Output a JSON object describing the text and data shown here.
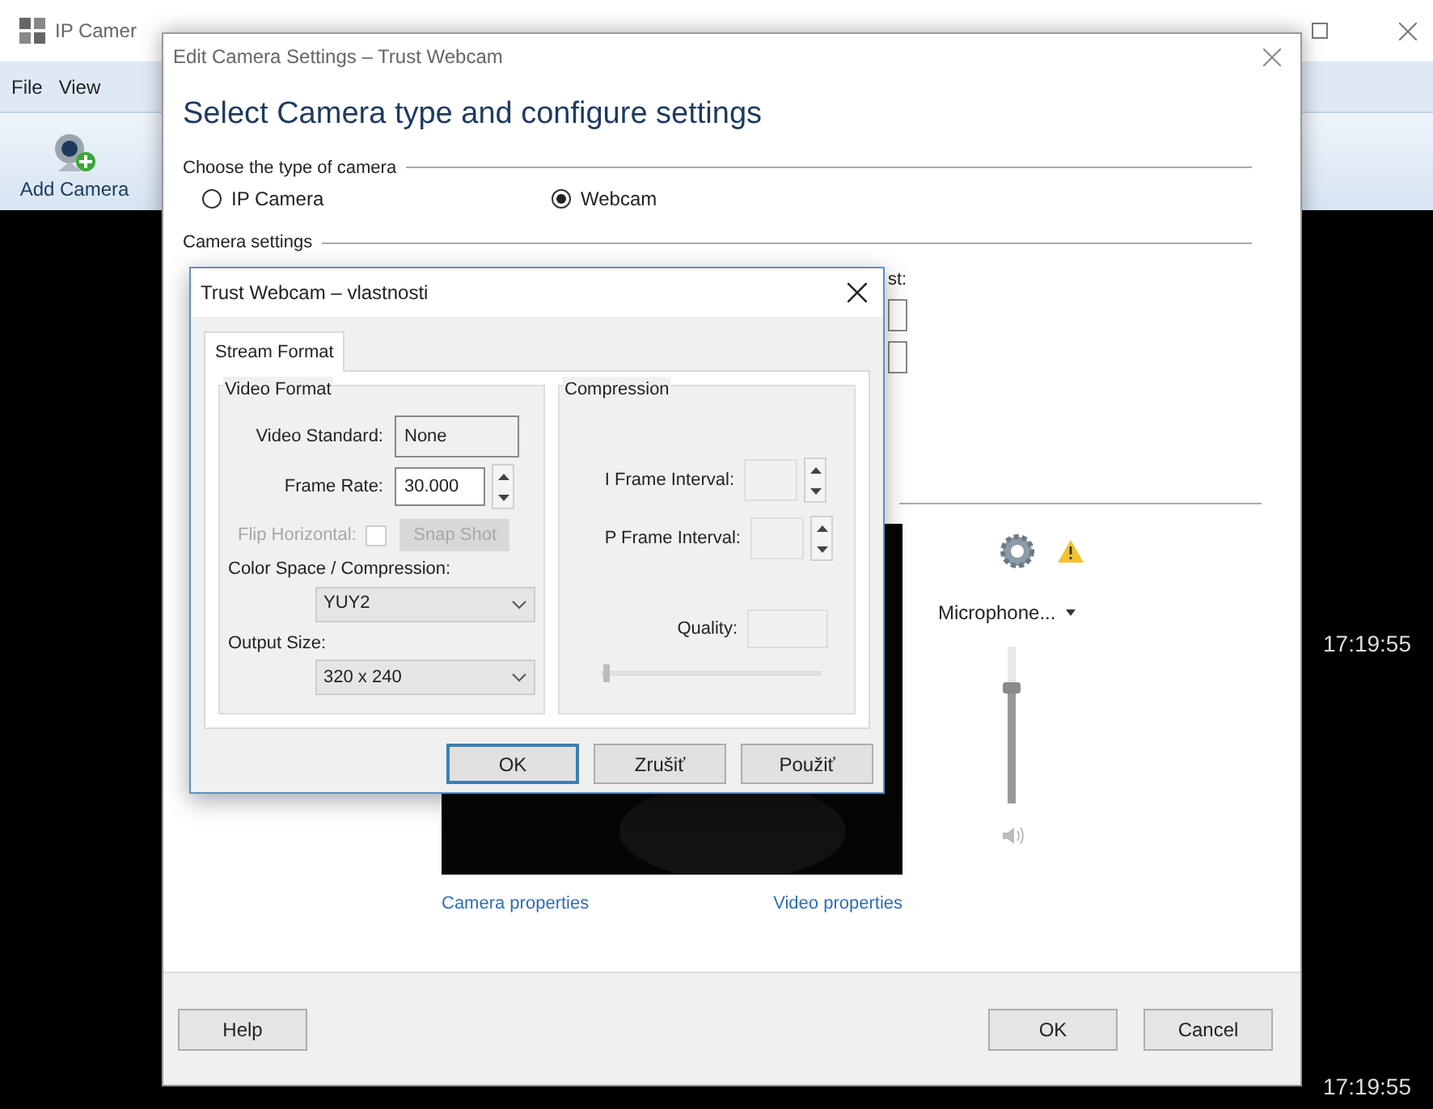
{
  "app_window": {
    "title": "IP Camer",
    "menu": [
      "File",
      "View"
    ],
    "toolbar": [
      {
        "label": "Add Camera"
      }
    ],
    "timestamps": [
      "17:19:55",
      "17:19:55"
    ]
  },
  "edit_dialog": {
    "title": "Edit Camera Settings – Trust Webcam",
    "heading": "Select Camera type and configure settings",
    "camera_type_group": "Choose the type of camera",
    "camera_types": [
      {
        "label": "IP Camera",
        "selected": false
      },
      {
        "label": "Webcam",
        "selected": true
      }
    ],
    "settings_group": "Camera settings",
    "partial_label": "st:",
    "audio_device": "Microphone...",
    "volume": {
      "level": 0.74
    },
    "links": [
      "Camera properties",
      "Video properties"
    ],
    "help_button": "Help",
    "buttons": [
      "OK",
      "Cancel"
    ]
  },
  "properties_dialog": {
    "title": "Trust Webcam – vlastnosti",
    "tabs": [
      {
        "label": "Stream Format",
        "selected": true
      }
    ],
    "video_format": {
      "title": "Video Format",
      "video_standard_label": "Video Standard:",
      "video_standard": "None",
      "frame_rate_label": "Frame Rate:",
      "frame_rate": "30.000",
      "flip": {
        "label": "Flip Horizontal:",
        "checked": false,
        "disabled": true
      },
      "snapshot": {
        "label": "Snap Shot",
        "disabled": true
      },
      "color_space_label": "Color Space / Compression:",
      "color_space": "YUY2",
      "output_size_label": "Output Size:",
      "output_size": "320 x 240"
    },
    "compression": {
      "title": "Compression",
      "i_frame_label": "I Frame Interval:",
      "p_frame_label": "P Frame Interval:",
      "quality_label": "Quality:",
      "quality_slider": {
        "level": 0
      }
    },
    "buttons": [
      {
        "label": "OK",
        "default": true
      },
      {
        "label": "Zrušiť",
        "default": false
      },
      {
        "label": "Použiť",
        "default": false
      }
    ]
  }
}
